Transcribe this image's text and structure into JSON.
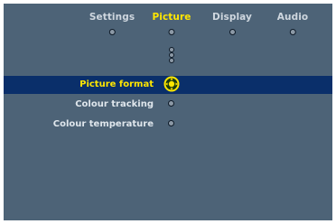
{
  "tabs": [
    {
      "label": "Settings",
      "active": false
    },
    {
      "label": "Picture",
      "active": true
    },
    {
      "label": "Display",
      "active": false
    },
    {
      "label": "Audio",
      "active": false
    }
  ],
  "menu": {
    "items": [
      {
        "label": "Picture format",
        "selected": true
      },
      {
        "label": "Colour tracking",
        "selected": false
      },
      {
        "label": "Colour temperature",
        "selected": false
      }
    ]
  },
  "colors": {
    "panel_background": "#4d6377",
    "highlight_bar": "#0a2f6a",
    "active_text": "#ffe600",
    "inactive_text": "#cfd7df"
  }
}
